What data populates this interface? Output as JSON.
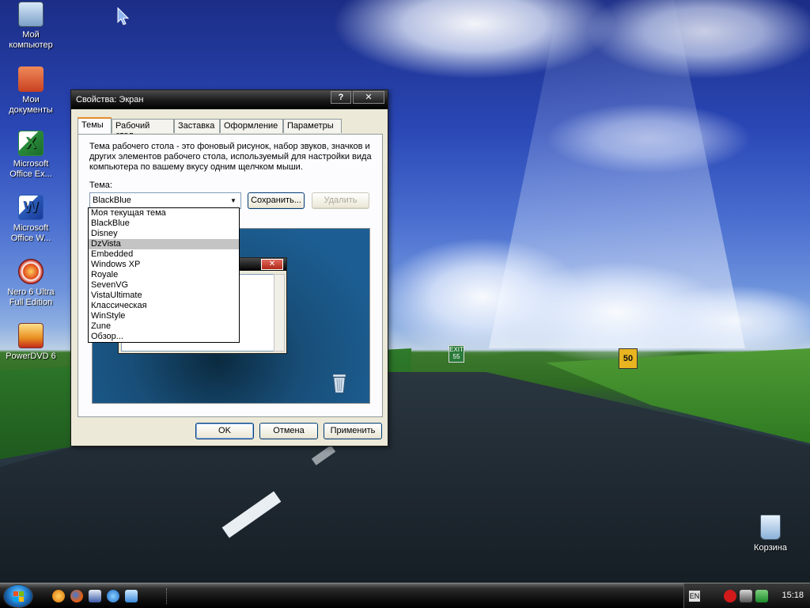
{
  "desktop": {
    "icons": [
      {
        "name": "my-computer",
        "label_line1": "Мой",
        "label_line2": "компьютер",
        "color": "#b8d4f0"
      },
      {
        "name": "my-documents",
        "label_line1": "Мои",
        "label_line2": "документы",
        "color": "#e8603a"
      },
      {
        "name": "excel",
        "label_line1": "Microsoft",
        "label_line2": "Office Ex...",
        "color": "#2a8a3a"
      },
      {
        "name": "word",
        "label_line1": "Microsoft",
        "label_line2": "Office W...",
        "color": "#2a5ab8"
      },
      {
        "name": "nero",
        "label_line1": "Nero 6 Ultra",
        "label_line2": "Full Edition",
        "color": "#c42a1a"
      },
      {
        "name": "powerdvd",
        "label_line1": "PowerDVD 6",
        "label_line2": "",
        "color": "#e8a020"
      }
    ],
    "recycle_bin": "Корзина",
    "sign_exit": "EXIT 55",
    "sign_speed": "50"
  },
  "dialog": {
    "title": "Свойства: Экран",
    "help_button": "?",
    "close_button": "✕",
    "tabs": [
      "Темы",
      "Рабочий стол",
      "Заставка",
      "Оформление",
      "Параметры"
    ],
    "description": "Тема рабочего стола - это фоновый рисунок, набор звуков, значков и других элементов рабочего стола, используемый для настройки вида компьютера по вашему вкусу одним щелчком мыши.",
    "theme_label": "Тема:",
    "theme_value": "BlackBlue",
    "save_button": "Сохранить...",
    "delete_button": "Удалить",
    "theme_options": [
      "Моя текущая тема",
      "BlackBlue",
      "Disney",
      "DzVista",
      "Embedded",
      "Windows XP",
      "Royale",
      "SevenVG",
      "VistaUltimate",
      "Классическая",
      "WinStyle",
      "Zune",
      "Обзор..."
    ],
    "highlighted_option": "DzVista",
    "ok_button": "OK",
    "cancel_button": "Отмена",
    "apply_button": "Применить"
  },
  "taskbar": {
    "language": "EN",
    "clock": "15:18"
  }
}
